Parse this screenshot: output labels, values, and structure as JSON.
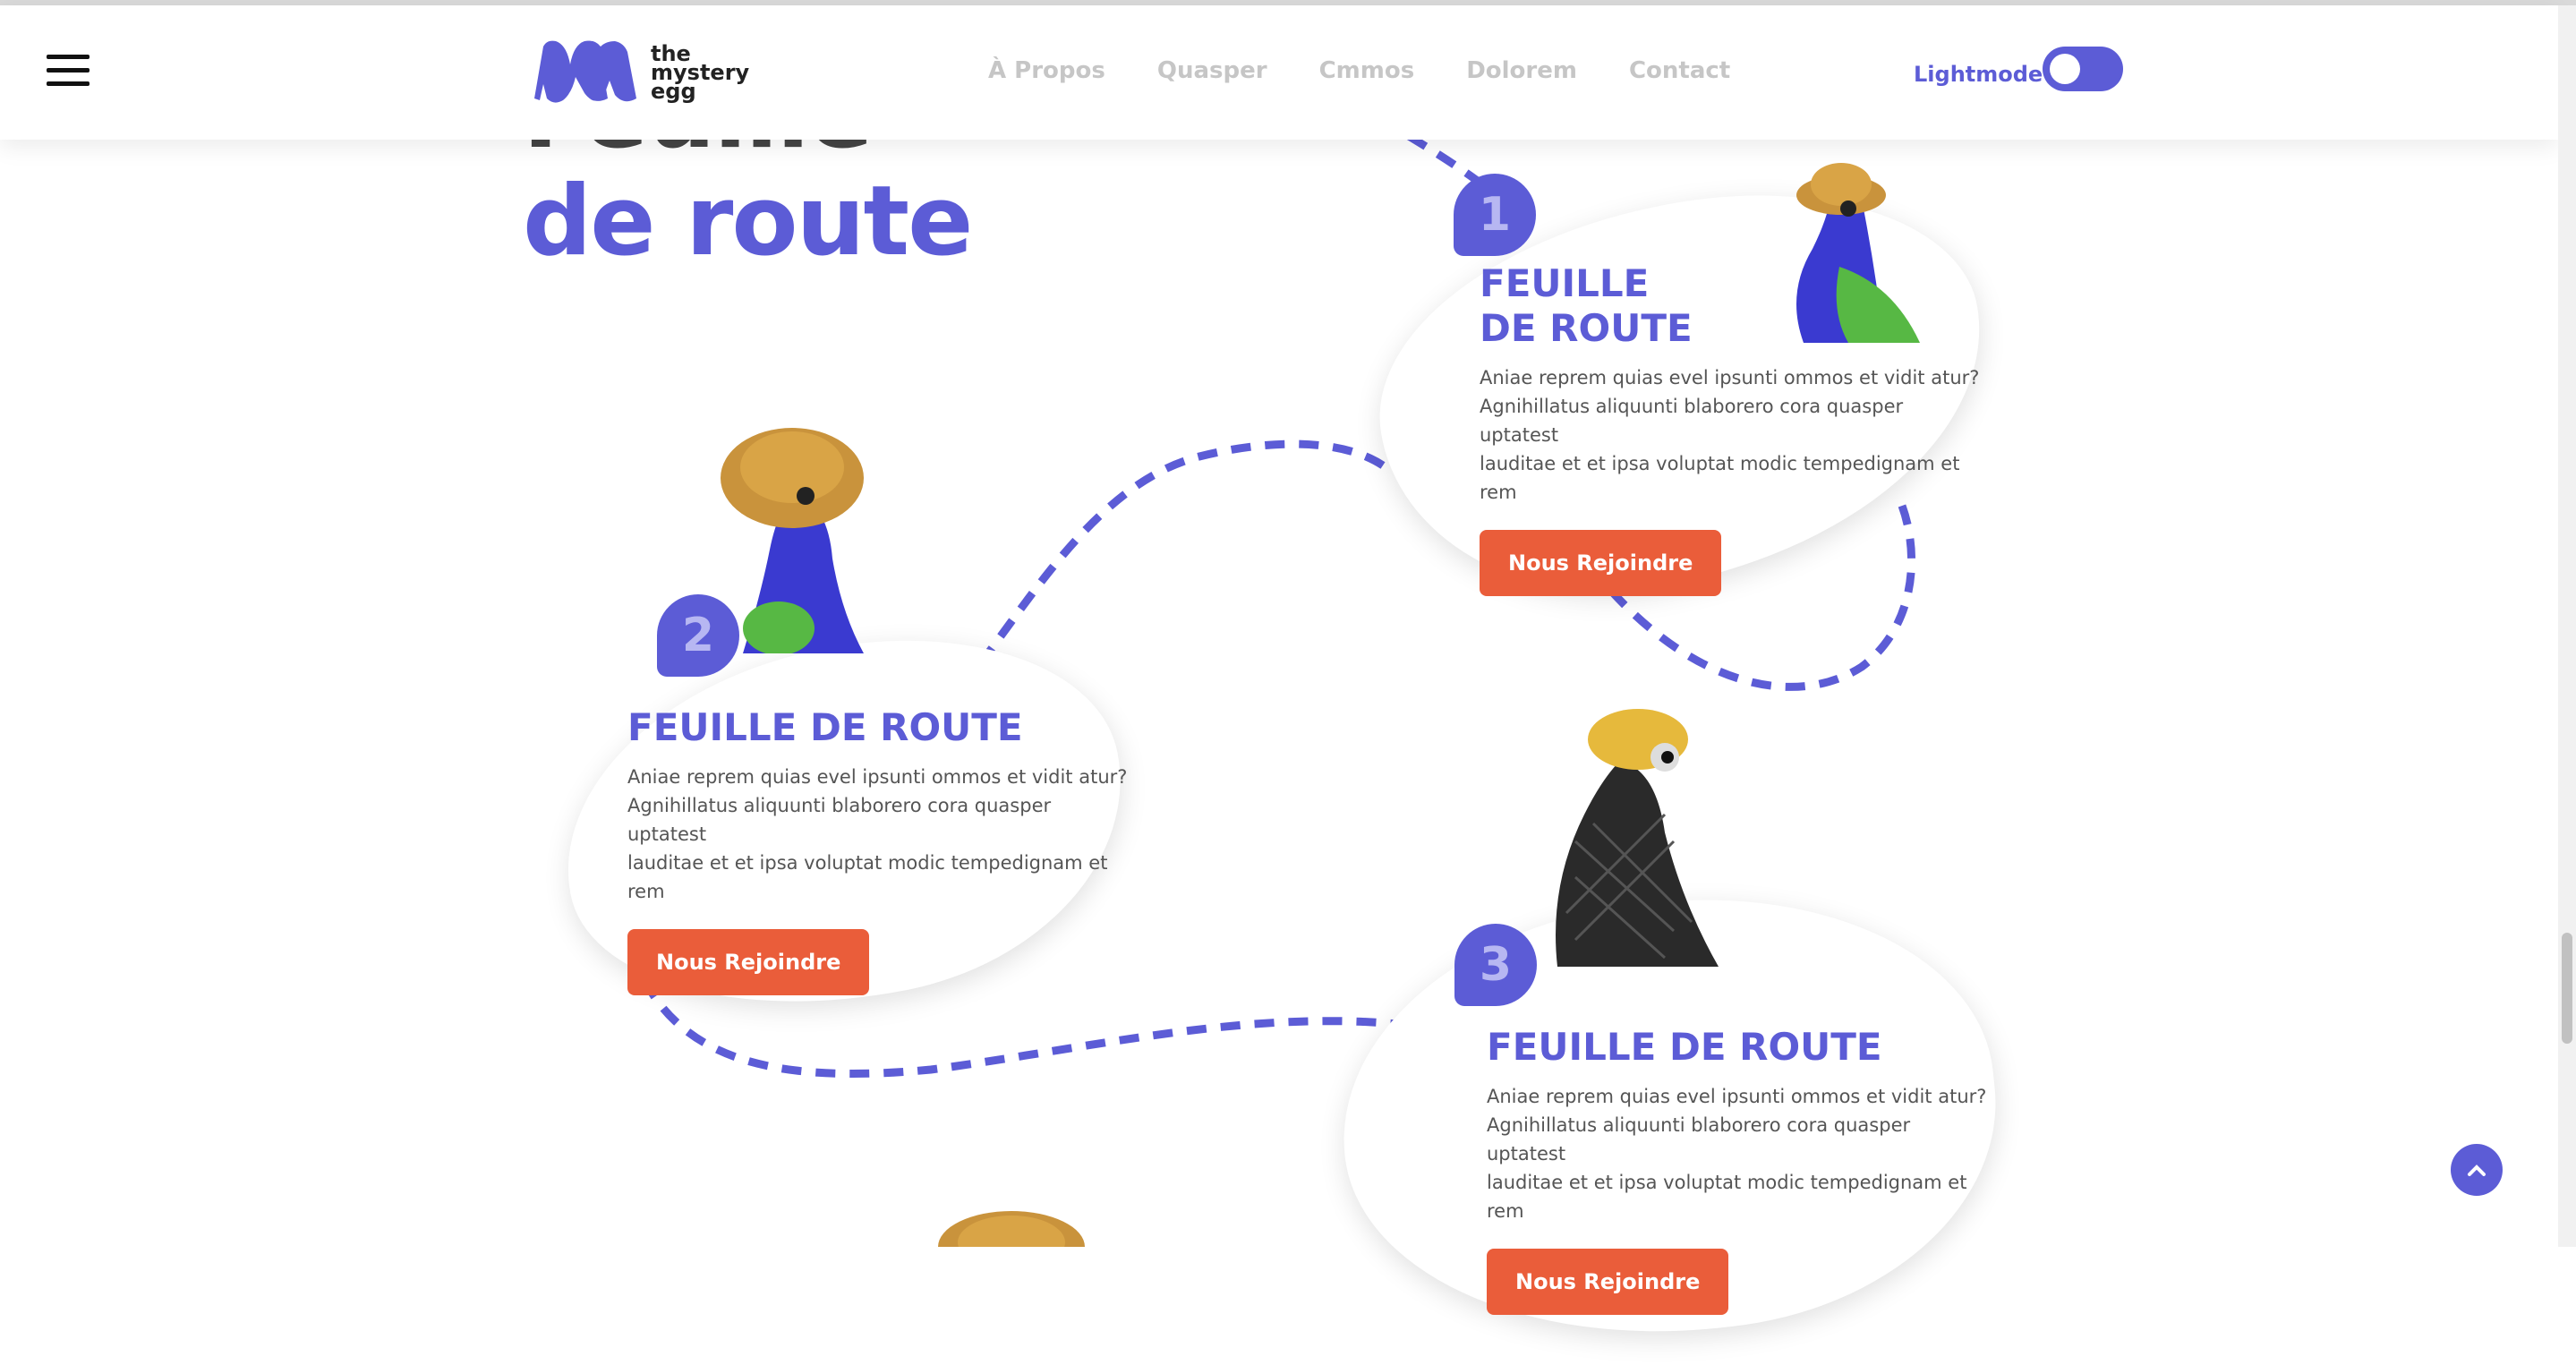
{
  "header": {
    "logo_text": "the\nmystery\negg",
    "nav": [
      "À Propos",
      "Quasper",
      "Cmmos",
      "Dolorem",
      "Contact"
    ],
    "mode_label": "Lightmode"
  },
  "section": {
    "title_line1": "Feuille",
    "title_line2": "de route"
  },
  "steps": [
    {
      "number": "1",
      "title": "FEUILLE\nDE ROUTE",
      "text": "Aniae reprem quias evel ipsunti ommos et vidit atur?\nAgnihillatus aliquunti blaborero cora quasper uptatest\nlauditae et et ipsa voluptat modic tempedignam et rem",
      "button": "Nous Rejoindre"
    },
    {
      "number": "2",
      "title": "FEUILLE DE ROUTE",
      "text": "Aniae reprem quias evel ipsunti ommos et vidit atur?\nAgnihillatus aliquunti blaborero cora quasper uptatest\nlauditae et et ipsa voluptat modic tempedignam et rem",
      "button": "Nous Rejoindre"
    },
    {
      "number": "3",
      "title": "FEUILLE DE ROUTE",
      "text": "Aniae reprem quias evel ipsunti ommos et vidit atur?\nAgnihillatus aliquunti blaborero cora quasper uptatest\nlauditae et et ipsa voluptat modic tempedignam et rem",
      "button": "Nous Rejoindre"
    }
  ],
  "icons": {
    "menu": "hamburger-menu-icon",
    "scroll_top": "chevron-up-icon"
  },
  "colors": {
    "accent": "#5c5cd6",
    "button": "#ea5d3a"
  }
}
